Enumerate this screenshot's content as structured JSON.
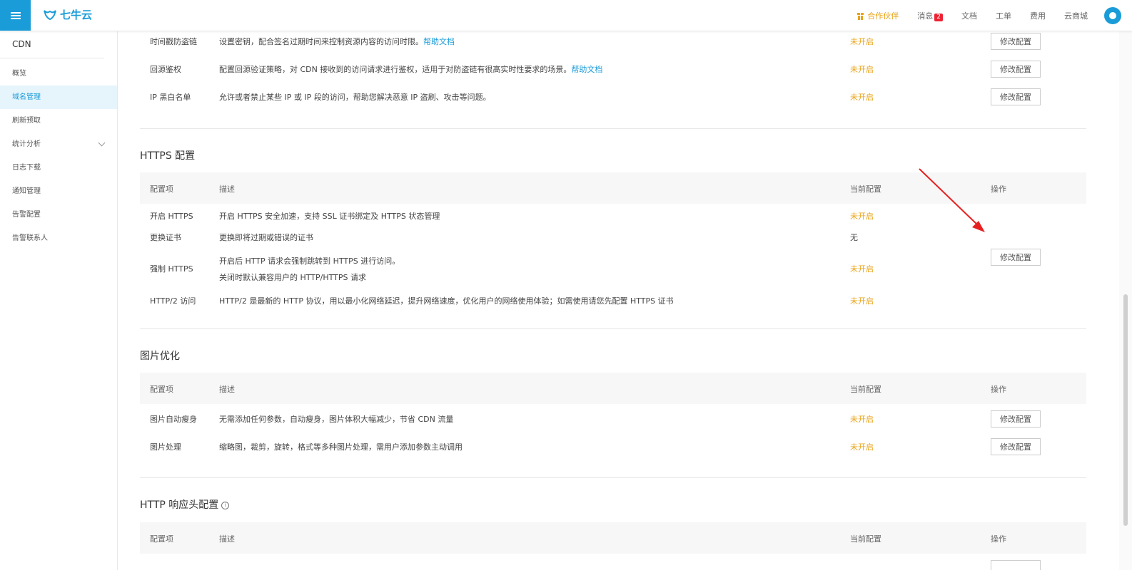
{
  "brand": {
    "name": "七牛云"
  },
  "topnav": {
    "partner": "合作伙伴",
    "messages": "消息",
    "message_count": "2",
    "docs": "文档",
    "tickets": "工单",
    "billing": "费用",
    "store": "云商城"
  },
  "sidebar": {
    "title": "CDN",
    "items": [
      {
        "label": "概览"
      },
      {
        "label": "域名管理",
        "active": true
      },
      {
        "label": "刷新预取"
      },
      {
        "label": "统计分析",
        "expandable": true
      },
      {
        "label": "日志下载"
      },
      {
        "label": "通知管理"
      },
      {
        "label": "告警配置"
      },
      {
        "label": "告警联系人"
      }
    ]
  },
  "access_rows": [
    {
      "name": "时间戳防盗链",
      "desc": "设置密钥，配合签名过期时间来控制资源内容的访问时限。",
      "link": "帮助文档",
      "current": "未开启",
      "action": "修改配置"
    },
    {
      "name": "回源鉴权",
      "desc": "配置回源验证策略，对 CDN 接收到的访问请求进行鉴权，适用于对防盗链有很高实时性要求的场景。",
      "link": "帮助文档",
      "current": "未开启",
      "action": "修改配置"
    },
    {
      "name": "IP 黑白名单",
      "desc": "允许或者禁止某些 IP 或 IP 段的访问，帮助您解决恶意 IP 盗刷、攻击等问题。",
      "current": "未开启",
      "action": "修改配置"
    }
  ],
  "https": {
    "title": "HTTPS 配置",
    "headers": {
      "name": "配置项",
      "desc": "描述",
      "current": "当前配置",
      "action": "操作"
    },
    "rows": [
      {
        "name": "开启 HTTPS",
        "desc": "开启 HTTPS 安全加速，支持 SSL 证书绑定及 HTTPS 状态管理",
        "current": "未开启"
      },
      {
        "name": "更换证书",
        "desc": "更换即将过期或错误的证书",
        "current": "无"
      },
      {
        "name": "强制 HTTPS",
        "desc": "开启后 HTTP 请求会强制跳转到 HTTPS 进行访问。",
        "desc2": "关闭时默认兼容用户的 HTTP/HTTPS 请求",
        "current": "未开启",
        "action": "修改配置"
      },
      {
        "name": "HTTP/2 访问",
        "desc": "HTTP/2 是最新的 HTTP 协议，用以最小化网络延迟，提升网络速度，优化用户的网络使用体验；如需使用请您先配置 HTTPS 证书",
        "current": "未开启"
      }
    ]
  },
  "image": {
    "title": "图片优化",
    "headers": {
      "name": "配置项",
      "desc": "描述",
      "current": "当前配置",
      "action": "操作"
    },
    "rows": [
      {
        "name": "图片自动瘦身",
        "desc": "无需添加任何参数，自动瘦身，图片体积大幅减少，节省 CDN 流量",
        "current": "未开启",
        "action": "修改配置"
      },
      {
        "name": "图片处理",
        "desc": "缩略图，裁剪，旋转，格式等多种图片处理，需用户添加参数主动调用",
        "current": "未开启",
        "action": "修改配置"
      }
    ]
  },
  "header_cfg": {
    "title": "HTTP 响应头配置",
    "info": "i",
    "headers": {
      "name": "配置项",
      "desc": "描述",
      "current": "当前配置",
      "action": "操作"
    }
  },
  "colors": {
    "accent": "#1a9cd8",
    "status": "#e8a317",
    "annotation": "#e62020"
  }
}
